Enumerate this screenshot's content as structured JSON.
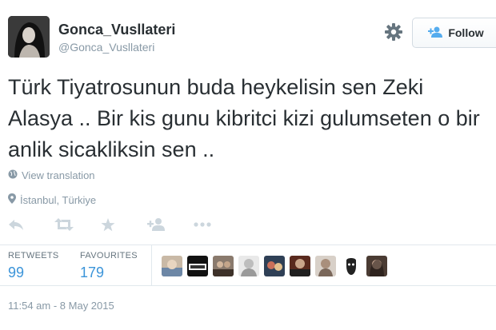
{
  "user": {
    "full_name": "Gonca_Vusllateri",
    "screen_name": "@Gonca_Vusllateri"
  },
  "follow_button": {
    "label": "Follow",
    "icon": "add-user-icon"
  },
  "settings_icon": "gear-icon",
  "tweet": {
    "text": "Türk Tiyatrosunun buda heykelisin sen Zeki Alasya .. Bir kis gunu kibritci kizi gulumseten o bir anlik sicakliksin sen ..",
    "translation_link": "View translation",
    "location": "İstanbul, Türkiye",
    "timestamp": "11:54 am - 8 May 2015"
  },
  "actions": [
    "reply-icon",
    "retweet-icon",
    "favorite-icon",
    "follow-icon",
    "more-icon"
  ],
  "stats": {
    "retweets_label": "RETWEETS",
    "retweets_count": "99",
    "favourites_label": "FAVOURITES",
    "favourites_count": "179"
  },
  "favoriters_count_shown": 9,
  "colors": {
    "text": "#292f33",
    "muted": "#8899a6",
    "link_blue": "#3b94d9",
    "divider": "#e1e8ed",
    "icon_gray": "#ccd6dd"
  }
}
